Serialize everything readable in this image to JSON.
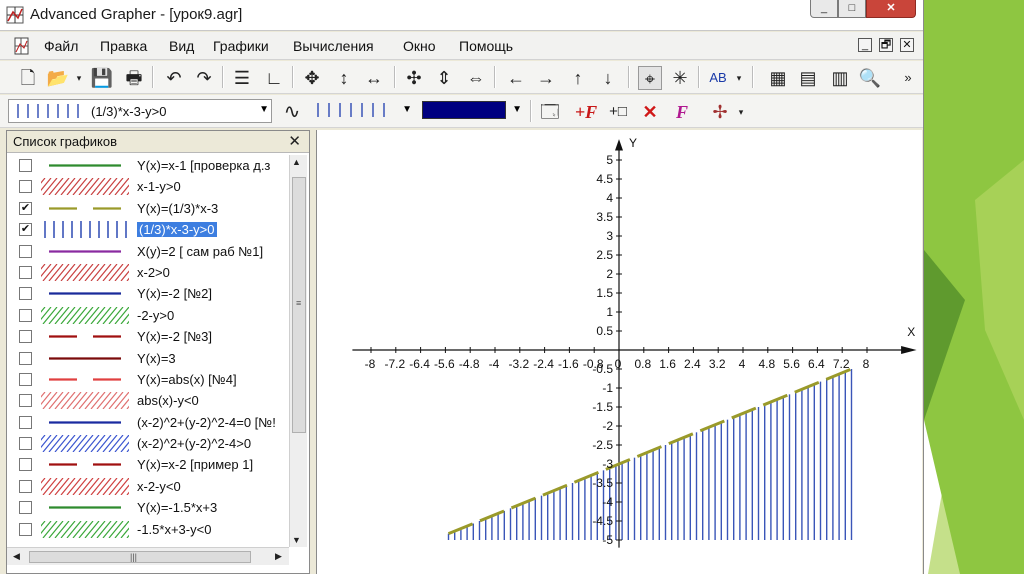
{
  "window": {
    "title": "Advanced Grapher - [урок9.agr]",
    "buttons": {
      "minimize": "_",
      "maximize": "□",
      "close": "✕"
    }
  },
  "menu": {
    "items": [
      "Файл",
      "Правка",
      "Вид",
      "Графики",
      "Вычисления",
      "Окно",
      "Помощь"
    ],
    "mdi_buttons": {
      "minimize": "_",
      "restore": "🗗",
      "close": "✕"
    }
  },
  "toolbar1": {
    "icons": [
      "new-icon",
      "open-icon",
      "save-icon",
      "print-icon",
      "undo-icon",
      "redo-icon",
      "grid-lines-icon",
      "axes-icon",
      "move-all-icon",
      "move-vertical-icon",
      "move-horizontal-icon",
      "zoom-all-icon",
      "zoom-vertical-icon",
      "zoom-horizontal-icon",
      "arrow-left-icon",
      "arrow-right-icon",
      "arrow-up-icon",
      "arrow-down-icon",
      "crosshair-icon",
      "asterisk-icon",
      "ab-text-icon",
      "calculator-icon",
      "table-icon",
      "spreadsheet-icon",
      "zoom-tool-icon",
      "overflow-icon"
    ],
    "ab_label": "AB"
  },
  "toolbar2": {
    "selected_graph": "(1/3)*x-3-y>0",
    "fill_color": "#000080",
    "icons": [
      "graph-properties-icon",
      "add-formula-icon",
      "add-point-icon",
      "delete-graph-icon",
      "edit-formula-icon",
      "tangent-icon"
    ]
  },
  "panel": {
    "title": "Список графиков",
    "close": "✕",
    "scroll_grip": "≡",
    "items": [
      {
        "label": "Y(x)=x-1 [проверка д.з",
        "checked": false,
        "style": "line",
        "color": "#2e8b2e"
      },
      {
        "label": "x-1-y>0",
        "checked": false,
        "style": "hatch",
        "color": "#c94040"
      },
      {
        "label": "Y(x)=(1/3)*x-3",
        "checked": true,
        "style": "dash",
        "color": "#9a9a2a"
      },
      {
        "label": "(1/3)*x-3-y>0",
        "checked": true,
        "style": "vbars",
        "color": "#3a55b8",
        "selected": true
      },
      {
        "label": "X(y)=2 [ сам раб №1]",
        "checked": false,
        "style": "line",
        "color": "#8a2aa0"
      },
      {
        "label": "x-2>0",
        "checked": false,
        "style": "hatch",
        "color": "#c94040"
      },
      {
        "label": "Y(x)=-2 [№2]",
        "checked": false,
        "style": "line",
        "color": "#1a2a9a"
      },
      {
        "label": "-2-y>0",
        "checked": false,
        "style": "hatch",
        "color": "#3aa83a"
      },
      {
        "label": "Y(x)=-2 [№3]",
        "checked": false,
        "style": "dash",
        "color": "#a01010"
      },
      {
        "label": "Y(x)=3",
        "checked": false,
        "style": "line",
        "color": "#7a0a0a"
      },
      {
        "label": "Y(x)=abs(x) [№4]",
        "checked": false,
        "style": "dash",
        "color": "#e04040"
      },
      {
        "label": "abs(x)-y<0",
        "checked": false,
        "style": "hatch",
        "color": "#e07070"
      },
      {
        "label": "(x-2)^2+(y-2)^2-4=0 [№!",
        "checked": false,
        "style": "line",
        "color": "#1a2aa0"
      },
      {
        "label": "(x-2)^2+(y-2)^2-4>0",
        "checked": false,
        "style": "hatch",
        "color": "#3a55d0"
      },
      {
        "label": "Y(x)=x-2 [пример 1]",
        "checked": false,
        "style": "dash",
        "color": "#a01010"
      },
      {
        "label": "x-2-y<0",
        "checked": false,
        "style": "hatch",
        "color": "#d04040"
      },
      {
        "label": "Y(x)=-1.5*x+3",
        "checked": false,
        "style": "line",
        "color": "#2e8b2e"
      },
      {
        "label": "-1.5*x+3-y<0",
        "checked": false,
        "style": "hatch",
        "color": "#3aa83a"
      }
    ]
  },
  "plot": {
    "x_axis_label": "X",
    "y_axis_label": "Y",
    "x_range": [
      -8,
      8
    ],
    "y_range": [
      -5,
      5
    ],
    "x_ticks": [
      "-8",
      "-7.2",
      "-6.4",
      "-5.6",
      "-4.8",
      "-4",
      "-3.2",
      "-2.4",
      "-1.6",
      "-0.8",
      "0",
      "0.8",
      "1.6",
      "2.4",
      "3.2",
      "4",
      "4.8",
      "5.6",
      "6.4",
      "7.2",
      "8"
    ],
    "y_ticks": [
      "5",
      "4.5",
      "4",
      "3.5",
      "3",
      "2.5",
      "2",
      "1.5",
      "1",
      "0.5",
      "-0.5",
      "-1",
      "-1.5",
      "-2",
      "-2.5",
      "-3",
      "-3.5",
      "-4",
      "-4.5",
      "-5"
    ],
    "line": {
      "formula": "Y(x)=(1/3)*x-3",
      "slope": 0.3333,
      "intercept": -3,
      "color": "#9a9a2a"
    },
    "inequality": {
      "formula": "(1/3)*x-3-y>0",
      "color": "#3a55b8",
      "x_from": -5.5,
      "x_to": 7.6
    }
  },
  "colors": {
    "accent_green": "#8ec641",
    "selection": "#3d7ee0"
  }
}
